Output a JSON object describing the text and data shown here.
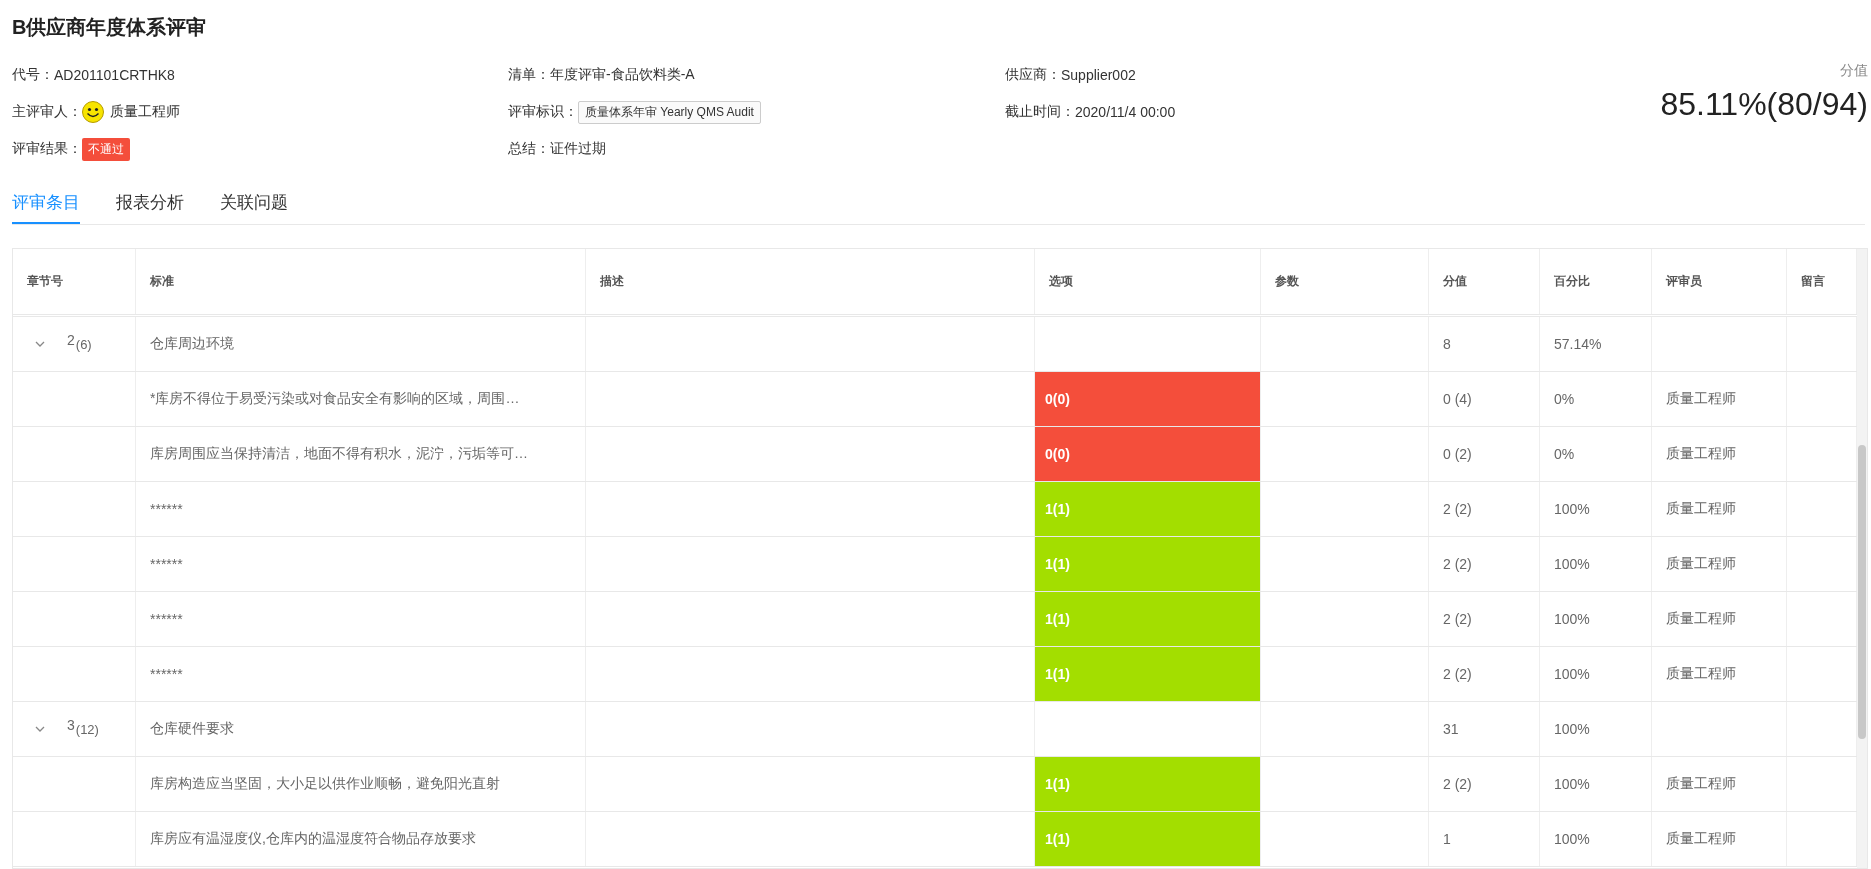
{
  "title": "B供应商年度体系评审",
  "info": [
    {
      "label": "代号：",
      "value": "AD201101CRTHK8"
    },
    {
      "label": "清单：",
      "value": "年度评审-食品饮料类-A"
    },
    {
      "label": "供应商：",
      "value": "Supplier002"
    },
    {
      "label": "主评审人：",
      "kind": "person",
      "value": "质量工程师"
    },
    {
      "label": "评审标识：",
      "kind": "tag",
      "value": "质量体系年审 Yearly QMS Audit"
    },
    {
      "label": "截止时间：",
      "value": "2020/11/4 00:00"
    },
    {
      "label": "评审结果：",
      "kind": "badge",
      "value": "不通过"
    },
    {
      "label": "总结：",
      "value": "证件过期"
    }
  ],
  "score": {
    "label": "分值",
    "value": "85.11%(80/94)"
  },
  "tabs": [
    {
      "label": "评审条目",
      "selected": true
    },
    {
      "label": "报表分析",
      "selected": false
    },
    {
      "label": "关联问题",
      "selected": false
    }
  ],
  "table": {
    "columns": [
      "章节号",
      "标准",
      "描述",
      "选项",
      "参数",
      "分值",
      "百分比",
      "评审员",
      "留言"
    ],
    "rows": [
      {
        "kind": "group",
        "expanded": true,
        "chapter": "2",
        "count": "(6)",
        "standard": "仓库周边环境",
        "score": "8",
        "percent": "57.14%"
      },
      {
        "kind": "item",
        "standard": "*库房不得位于易受污染或对食品安全有影响的区域，周围…",
        "option": "0(0)",
        "color": "#f44e3b",
        "score": "0 (4)",
        "percent": "0%",
        "reviewer": "质量工程师"
      },
      {
        "kind": "item",
        "standard": "库房周围应当保持清洁，地面不得有积水，泥泞，污垢等可…",
        "option": "0(0)",
        "color": "#f44e3b",
        "score": "0 (2)",
        "percent": "0%",
        "reviewer": "质量工程师"
      },
      {
        "kind": "item",
        "standard": "******",
        "option": "1(1)",
        "color": "#a3de00",
        "score": "2 (2)",
        "percent": "100%",
        "reviewer": "质量工程师"
      },
      {
        "kind": "item",
        "standard": "******",
        "option": "1(1)",
        "color": "#a3de00",
        "score": "2 (2)",
        "percent": "100%",
        "reviewer": "质量工程师"
      },
      {
        "kind": "item",
        "standard": "******",
        "option": "1(1)",
        "color": "#a3de00",
        "score": "2 (2)",
        "percent": "100%",
        "reviewer": "质量工程师"
      },
      {
        "kind": "item",
        "standard": "******",
        "option": "1(1)",
        "color": "#a3de00",
        "score": "2 (2)",
        "percent": "100%",
        "reviewer": "质量工程师"
      },
      {
        "kind": "group",
        "expanded": true,
        "chapter": "3",
        "count": "(12)",
        "standard": "仓库硬件要求",
        "score": "31",
        "percent": "100%"
      },
      {
        "kind": "item",
        "standard": "库房构造应当坚固，大小足以供作业顺畅，避免阳光直射",
        "option": "1(1)",
        "color": "#a3de00",
        "score": "2 (2)",
        "percent": "100%",
        "reviewer": "质量工程师"
      },
      {
        "kind": "item",
        "standard": "库房应有温湿度仪,仓库内的温湿度符合物品存放要求",
        "option": "1(1)",
        "color": "#a3de00",
        "score": "1",
        "percent": "100%",
        "reviewer": "质量工程师"
      }
    ]
  }
}
